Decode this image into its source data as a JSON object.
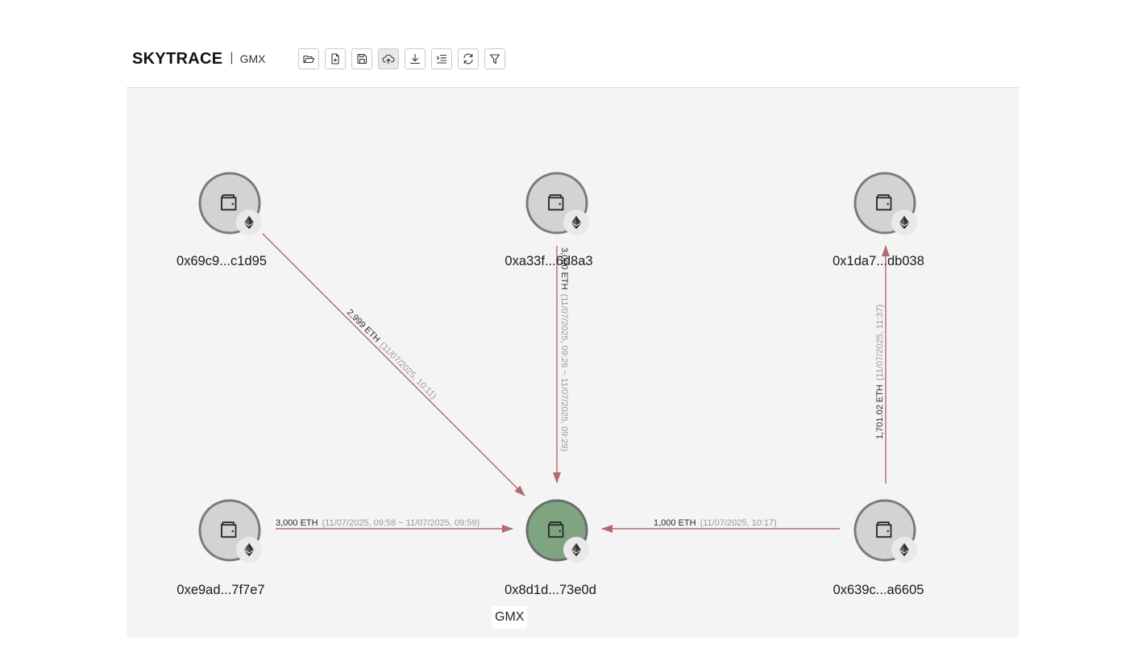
{
  "app": {
    "brand": "SKYTRACE",
    "separator": "|",
    "project": "GMX"
  },
  "toolbar": {
    "buttons": [
      {
        "name": "open-folder-icon",
        "active": false
      },
      {
        "name": "new-file-icon",
        "active": false
      },
      {
        "name": "save-icon",
        "active": false
      },
      {
        "name": "cloud-upload-icon",
        "active": true
      },
      {
        "name": "download-icon",
        "active": false
      },
      {
        "name": "list-indent-icon",
        "active": false
      },
      {
        "name": "refresh-icon",
        "active": false
      },
      {
        "name": "filter-icon",
        "active": false
      }
    ]
  },
  "colors": {
    "node_fill": "#d3d3d5",
    "node_stroke": "#7a7a7a",
    "target_fill": "#7ea481",
    "edge": "#b36a72",
    "canvas": "#f4f4f4"
  },
  "nodes": {
    "n1": {
      "address": "0x69c9...c1d95",
      "icon": "wallet-icon",
      "badge": "ethereum-icon"
    },
    "n2": {
      "address": "0xa33f...6d8a3",
      "icon": "wallet-icon",
      "badge": "ethereum-icon"
    },
    "n3": {
      "address": "0x1da7...db038",
      "icon": "wallet-icon",
      "badge": "ethereum-icon"
    },
    "n4": {
      "address": "0xe9ad...7f7e7",
      "icon": "wallet-icon",
      "badge": "ethereum-icon"
    },
    "n5": {
      "address": "0x8d1d...73e0d",
      "icon": "wallet-icon",
      "badge": "ethereum-icon",
      "highlighted": true
    },
    "n6": {
      "address": "0x639c...a6605",
      "icon": "wallet-icon",
      "badge": "ethereum-icon"
    }
  },
  "edges": {
    "e1": {
      "from": "0x69c9...c1d95",
      "to": "0x8d1d...73e0d",
      "amount": "2,999 ETH",
      "time": "(11/07/2025, 10:11)"
    },
    "e2": {
      "from": "0xa33f...6d8a3",
      "to": "0x8d1d...73e0d",
      "amount": "3,000 ETH",
      "time": "(11/07/2025, 09:26 ~ 11/07/2025, 09:29)"
    },
    "e3": {
      "from": "0x639c...a6605",
      "to": "0x1da7...db038",
      "amount": "1,701.02 ETH",
      "time": "(11/07/2025, 11:37)"
    },
    "e4": {
      "from": "0xe9ad...7f7e7",
      "to": "0x8d1d...73e0d",
      "amount": "3,000 ETH",
      "time": "(11/07/2025, 09:58 ~ 11/07/2025, 09:59)"
    },
    "e5": {
      "from": "0x639c...a6605",
      "to": "0x8d1d...73e0d",
      "amount": "1,000 ETH",
      "time": "(11/07/2025, 10:17)"
    }
  },
  "tag": {
    "label": "GMX"
  }
}
